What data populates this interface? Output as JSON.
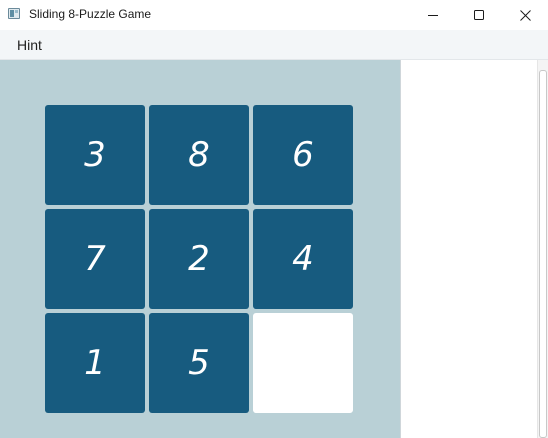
{
  "window": {
    "title": "Sliding 8-Puzzle Game",
    "icon": "app-window-icon"
  },
  "menu": {
    "items": [
      {
        "label": "Hint"
      }
    ]
  },
  "board": {
    "tiles": [
      "3",
      "8",
      "6",
      "7",
      "2",
      "4",
      "1",
      "5",
      ""
    ],
    "colors": {
      "tile": "#175b7f",
      "empty": "#ffffff",
      "background": "#b9d0d6",
      "number": "#ffffff"
    }
  },
  "side_panel": {
    "content": ""
  }
}
